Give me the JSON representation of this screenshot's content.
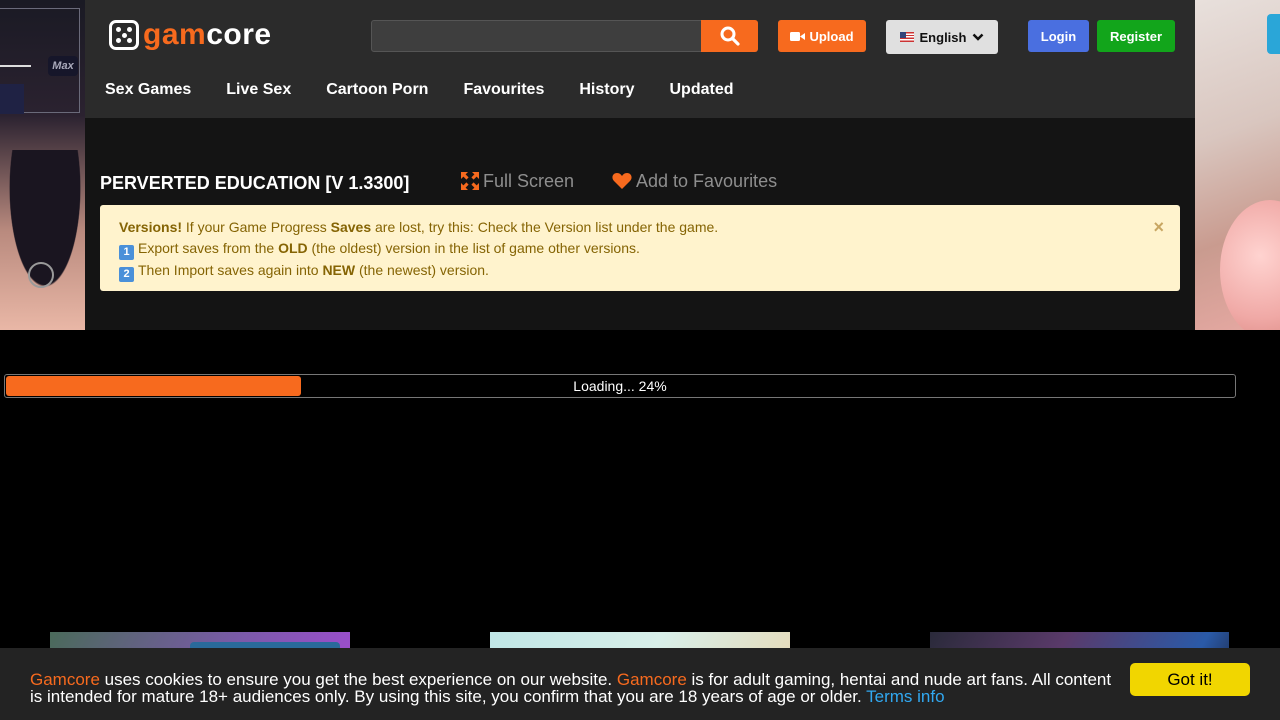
{
  "header": {
    "logo": {
      "part1": "gam",
      "part2": "core"
    },
    "search": {
      "placeholder": "",
      "value": ""
    },
    "upload_label": "Upload",
    "language_label": "English",
    "login_label": "Login",
    "register_label": "Register"
  },
  "nav": {
    "items": [
      {
        "label": "Sex Games"
      },
      {
        "label": "Live Sex"
      },
      {
        "label": "Cartoon Porn"
      },
      {
        "label": "Favourites"
      },
      {
        "label": "History"
      },
      {
        "label": "Updated"
      }
    ]
  },
  "game": {
    "title": "PERVERTED EDUCATION [V 1.3300]",
    "fullscreen_label": "Full Screen",
    "favourite_label": "Add to Favourites"
  },
  "alert": {
    "line1_bold1": "Versions!",
    "line1_text1": " If your Game Progress ",
    "line1_bold2": "Saves",
    "line1_text2": " are lost, try this: Check the Version list under the game.",
    "line2_num": "1",
    "line2_text1": "Export saves from the ",
    "line2_bold": "OLD",
    "line2_text2": " (the oldest) version in the list of game other versions.",
    "line3_num": "2",
    "line3_text1": "Then Import saves again into ",
    "line3_bold": "NEW",
    "line3_text2": " (the newest) version.",
    "close_label": "×"
  },
  "loader": {
    "text": "Loading... 24%",
    "progress": 0.24
  },
  "cookie": {
    "brand1": "Gamcore",
    "text1": " uses cookies to ensure you get the best experience on our website. ",
    "brand2": "Gamcore",
    "text2": " is for adult gaming, hentai and nude art fans. All content is intended for mature 18+ audiences only. By using this site, you confirm that you are 18 years of age or older. ",
    "terms_label": "Terms info",
    "button_label": "Got it!"
  },
  "ads": {
    "left_badge": "Max"
  },
  "colors": {
    "accent": "#f76a1e",
    "login": "#4a6fe0",
    "register": "#12a51b",
    "cookie_button": "#f1d600",
    "alert_bg": "#fff3cd"
  }
}
